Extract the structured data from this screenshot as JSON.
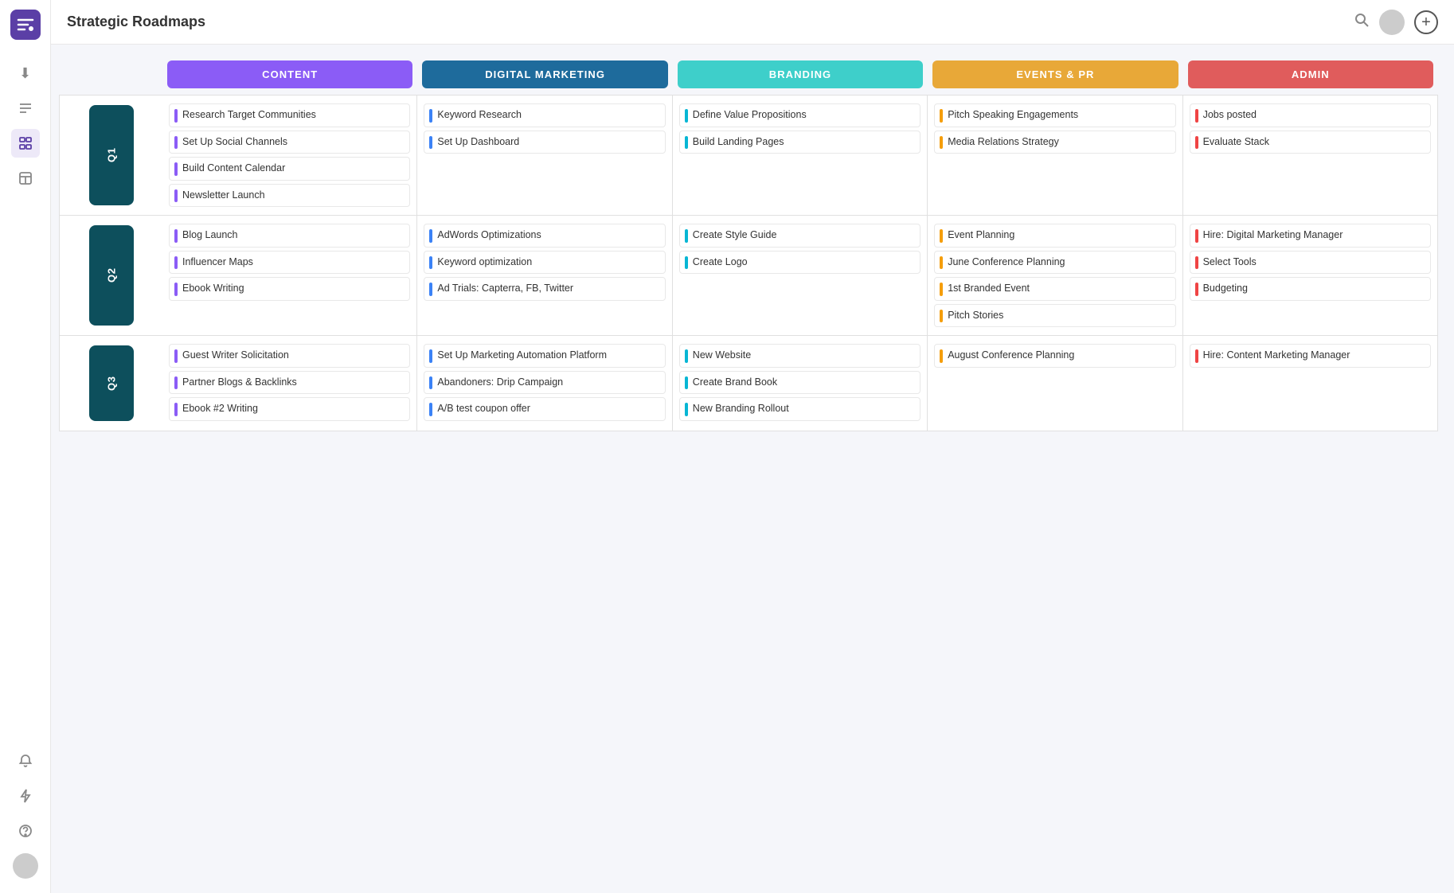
{
  "app": {
    "title": "Strategic Roadmaps"
  },
  "sidebar": {
    "items": [
      {
        "name": "download-icon",
        "label": "Download",
        "glyph": "⬇",
        "active": false
      },
      {
        "name": "list-icon",
        "label": "List",
        "glyph": "☰",
        "active": false
      },
      {
        "name": "roadmap-icon",
        "label": "Roadmap",
        "glyph": "⊞",
        "active": true
      },
      {
        "name": "template-icon",
        "label": "Template",
        "glyph": "⊡",
        "active": false
      },
      {
        "name": "bell-icon",
        "label": "Bell",
        "glyph": "🔔",
        "active": false
      },
      {
        "name": "bolt-icon",
        "label": "Bolt",
        "glyph": "⚡",
        "active": false
      },
      {
        "name": "help-icon",
        "label": "Help",
        "glyph": "?",
        "active": false
      }
    ]
  },
  "columns": [
    {
      "id": "content",
      "label": "CONTENT",
      "colorClass": "header-purple",
      "dotClass": "color-purple"
    },
    {
      "id": "digital_marketing",
      "label": "DIGITAL MARKETING",
      "colorClass": "header-blue",
      "dotClass": "color-blue"
    },
    {
      "id": "branding",
      "label": "BRANDING",
      "colorClass": "header-teal",
      "dotClass": "color-teal"
    },
    {
      "id": "events_pr",
      "label": "EVENTS & PR",
      "colorClass": "header-orange",
      "dotClass": "color-orange"
    },
    {
      "id": "admin",
      "label": "ADMIN",
      "colorClass": "header-red",
      "dotClass": "color-red"
    }
  ],
  "quarters": [
    {
      "label": "Q1",
      "rows": {
        "content": [
          "Research Target Communities",
          "Set Up Social Channels",
          "Build Content Calendar",
          "Newsletter Launch"
        ],
        "digital_marketing": [
          "Keyword Research",
          "Set Up Dashboard"
        ],
        "branding": [
          "Define Value Propositions",
          "Build Landing Pages"
        ],
        "events_pr": [
          "Pitch Speaking Engagements",
          "Media Relations Strategy"
        ],
        "admin": [
          "Jobs posted",
          "Evaluate Stack"
        ]
      }
    },
    {
      "label": "Q2",
      "rows": {
        "content": [
          "Blog Launch",
          "Influencer Maps",
          "Ebook Writing"
        ],
        "digital_marketing": [
          "AdWords Optimizations",
          "Keyword optimization",
          "Ad Trials: Capterra, FB, Twitter"
        ],
        "branding": [
          "Create Style Guide",
          "Create Logo"
        ],
        "events_pr": [
          "Event Planning",
          "June Conference Planning",
          "1st Branded Event",
          "Pitch Stories"
        ],
        "admin": [
          "Hire: Digital Marketing Manager",
          "Select Tools",
          "Budgeting"
        ]
      }
    },
    {
      "label": "Q3",
      "rows": {
        "content": [
          "Guest Writer Solicitation",
          "Partner Blogs & Backlinks",
          "Ebook #2 Writing"
        ],
        "digital_marketing": [
          "Set Up Marketing Automation Platform",
          "Abandoners: Drip Campaign",
          "A/B test coupon offer"
        ],
        "branding": [
          "New Website",
          "Create Brand Book",
          "New Branding Rollout"
        ],
        "events_pr": [
          "August Conference Planning"
        ],
        "admin": [
          "Hire: Content Marketing Manager"
        ]
      }
    }
  ]
}
